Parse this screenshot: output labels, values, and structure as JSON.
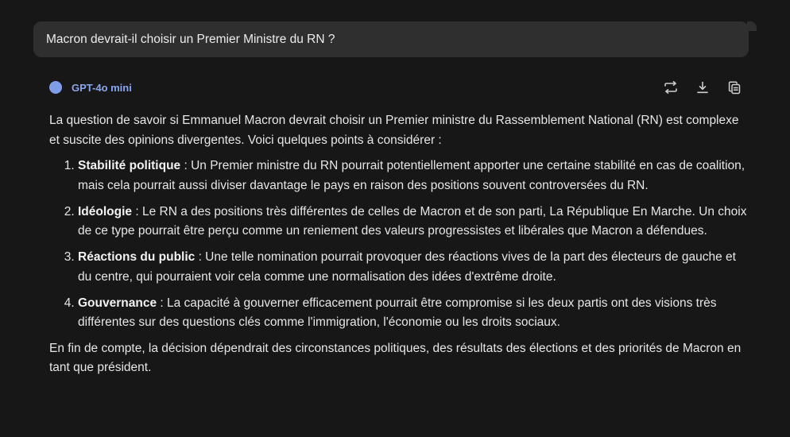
{
  "prompt": {
    "text": "Macron devrait-il choisir un Premier Ministre du RN ?"
  },
  "model": {
    "name": "GPT-4o mini",
    "dot_color": "#7f9de8"
  },
  "actions": [
    {
      "icon": "regenerate-icon"
    },
    {
      "icon": "download-icon"
    },
    {
      "icon": "copy-icon"
    }
  ],
  "answer": {
    "intro": "La question de savoir si Emmanuel Macron devrait choisir un Premier ministre du Rassemblement National (RN) est complexe et suscite des opinions divergentes. Voici quelques points à considérer :",
    "points": [
      {
        "title": "Stabilité politique",
        "text": " : Un Premier ministre du RN pourrait potentiellement apporter une certaine stabilité en cas de coalition, mais cela pourrait aussi diviser davantage le pays en raison des positions souvent controversées du RN."
      },
      {
        "title": "Idéologie",
        "text": " : Le RN a des positions très différentes de celles de Macron et de son parti, La République En Marche. Un choix de ce type pourrait être perçu comme un reniement des valeurs progressistes et libérales que Macron a défendues."
      },
      {
        "title": "Réactions du public",
        "text": " : Une telle nomination pourrait provoquer des réactions vives de la part des électeurs de gauche et du centre, qui pourraient voir cela comme une normalisation des idées d'extrême droite."
      },
      {
        "title": "Gouvernance",
        "text": " : La capacité à gouverner efficacement pourrait être compromise si les deux partis ont des visions très différentes sur des questions clés comme l'immigration, l'économie ou les droits sociaux."
      }
    ],
    "conclusion": "En fin de compte, la décision dépendrait des circonstances politiques, des résultats des élections et des priorités de Macron en tant que président."
  }
}
